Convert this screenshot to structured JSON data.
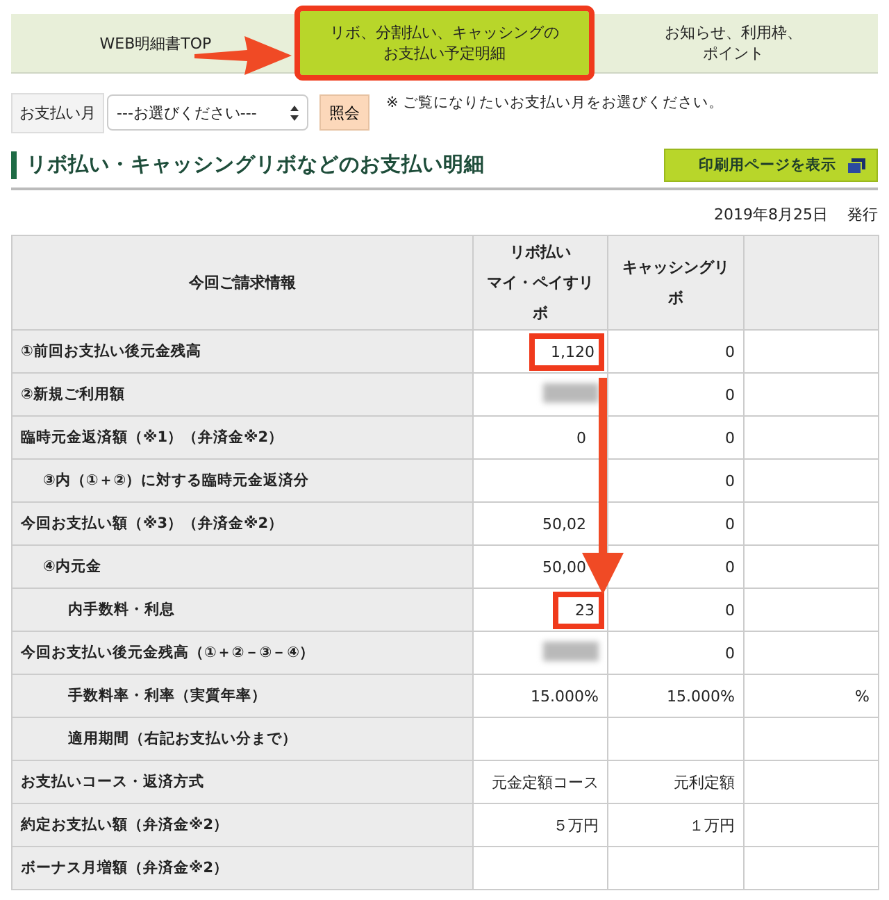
{
  "tabs": [
    {
      "lines": [
        "WEB明細書TOP"
      ],
      "selected": false,
      "highlighted": false
    },
    {
      "lines": [
        "リボ、分割払い、キャッシングの",
        "お支払い予定明細"
      ],
      "selected": true,
      "highlighted": true
    },
    {
      "lines": [
        "お知らせ、利用枠、",
        "ポイント"
      ],
      "selected": false,
      "highlighted": false
    }
  ],
  "month_picker": {
    "label": "お支払い月",
    "value": "---お選びください---",
    "button": "照会",
    "note": "※ ご覧になりたいお支払い月をお選びください。"
  },
  "heading": "リボ払い・キャッシングリボなどのお支払い明細",
  "print_button": "印刷用ページを表示",
  "issued": {
    "date": "2019年8月25日",
    "label": "発行"
  },
  "table": {
    "columns": [
      {
        "lines": [
          "今回ご請求情報"
        ]
      },
      {
        "lines": [
          "リボ払い",
          "マイ・ペイすリボ"
        ]
      },
      {
        "lines": [
          "キャッシングリボ"
        ]
      },
      {}
    ],
    "rows": [
      {
        "kind": "main",
        "cells": [
          {
            "text": "①前回お支払い後元金残高"
          },
          {
            "text": "1,120",
            "highlighted": true
          },
          {
            "text": "0"
          },
          {
            "text": ""
          }
        ]
      },
      {
        "kind": "main",
        "cells": [
          {
            "text": "②新規ご利用額"
          },
          {
            "redacted": true
          },
          {
            "text": "0"
          },
          {
            "text": ""
          }
        ]
      },
      {
        "kind": "main",
        "cells": [
          {
            "text": "臨時元金返済額（※1）（弁済金※2）"
          },
          {
            "text": "0",
            "kind": "beside_arrow"
          },
          {
            "text": "0"
          },
          {
            "text": ""
          }
        ]
      },
      {
        "kind": "sub",
        "cells": [
          {
            "text": "③内（①＋②）に対する臨時元金返済分"
          },
          {
            "text": ""
          },
          {
            "text": "0"
          },
          {
            "text": ""
          }
        ]
      },
      {
        "kind": "main",
        "cells": [
          {
            "text": "今回お支払い額（※3）（弁済金※2）"
          },
          {
            "text": "50,02",
            "kind": "beside_arrow"
          },
          {
            "text": "0"
          },
          {
            "text": ""
          }
        ]
      },
      {
        "kind": "sub",
        "cells": [
          {
            "text": "④内元金"
          },
          {
            "text": "50,00",
            "kind": "beside_arrow"
          },
          {
            "text": "0"
          },
          {
            "text": ""
          }
        ]
      },
      {
        "kind": "detail",
        "cells": [
          {
            "text": "内手数料・利息"
          },
          {
            "text": "23",
            "highlighted": true
          },
          {
            "text": "0"
          },
          {
            "text": ""
          }
        ]
      },
      {
        "kind": "main",
        "cells": [
          {
            "text": "今回お支払い後元金残高（①＋②－③－④）"
          },
          {
            "redacted": true
          },
          {
            "text": "0"
          },
          {
            "text": ""
          }
        ]
      },
      {
        "kind": "detail",
        "cells": [
          {
            "text": "手数料率・利率（実質年率）"
          },
          {
            "text": "15.000%"
          },
          {
            "text": "15.000%"
          },
          {
            "text": "%"
          }
        ]
      },
      {
        "kind": "detail",
        "cells": [
          {
            "text": "適用期間（右記お支払い分まで）"
          },
          {
            "text": ""
          },
          {
            "text": ""
          },
          {
            "text": ""
          }
        ]
      },
      {
        "kind": "main",
        "cells": [
          {
            "text": "お支払いコース・返済方式"
          },
          {
            "text": "元金定額コース"
          },
          {
            "text": "元利定額"
          },
          {
            "text": ""
          }
        ]
      },
      {
        "kind": "main",
        "cells": [
          {
            "text": "約定お支払い額（弁済金※2）"
          },
          {
            "text": "５万円"
          },
          {
            "text": "１万円"
          },
          {
            "text": ""
          }
        ]
      },
      {
        "kind": "main",
        "cells": [
          {
            "text": "ボーナス月増額（弁済金※2）"
          },
          {
            "text": ""
          },
          {
            "text": ""
          },
          {
            "text": ""
          }
        ]
      }
    ]
  }
}
